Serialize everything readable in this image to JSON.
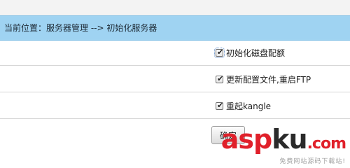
{
  "breadcrumb": {
    "text": "当前位置：服务器管理 --> 初始化服务器"
  },
  "options": [
    {
      "label": "初始化磁盘配额",
      "checked": true,
      "focused": true
    },
    {
      "label": "更新配置文件,重启FTP",
      "checked": true,
      "focused": false
    },
    {
      "label": "重起kangle",
      "checked": true,
      "focused": false
    }
  ],
  "confirm_button": {
    "label": "确定"
  },
  "watermark": {
    "asp": "asp",
    "ku": "ku",
    "com": ".com",
    "sub": "免费网站源码下载站!"
  },
  "colors": {
    "breadcrumb_bg": "#9fd3f2",
    "watermark_red": "#e0202a"
  }
}
